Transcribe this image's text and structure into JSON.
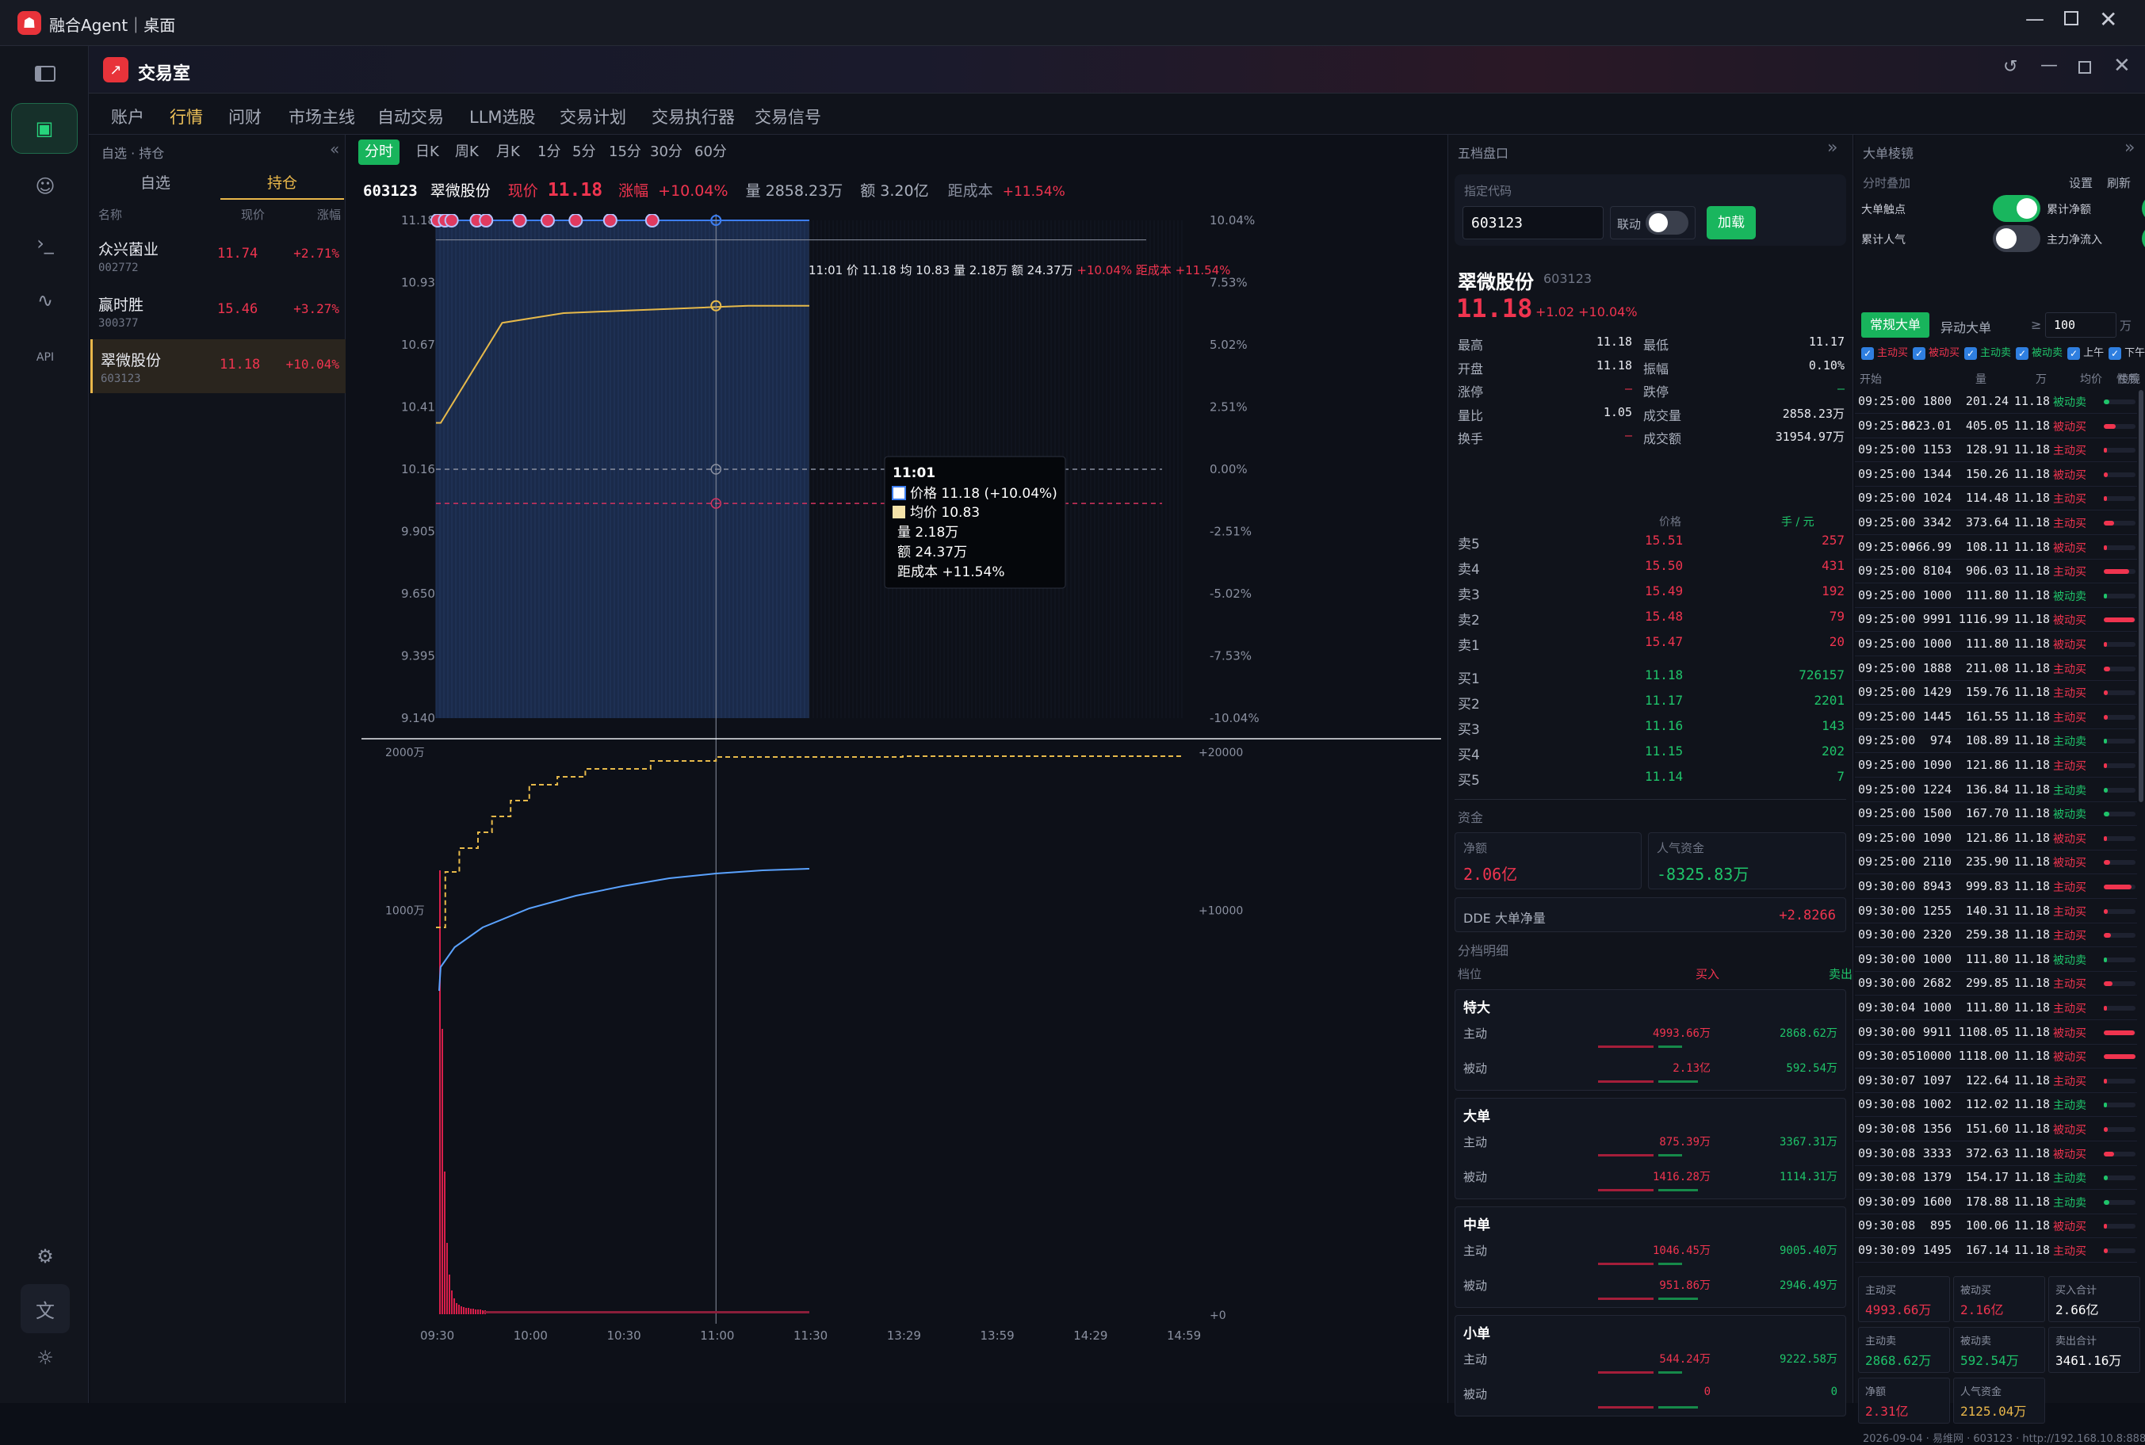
{
  "window": {
    "title": "融合Agent｜桌面",
    "min_icon": "minimize-icon",
    "max_icon": "maximize-icon",
    "close_icon": "close-icon"
  },
  "app": {
    "title": "交易室"
  },
  "tabs": [
    "账户",
    "行情",
    "问财",
    "市场主线",
    "自动交易",
    "LLM选股",
    "交易计划",
    "交易执行器",
    "交易信号"
  ],
  "active_tab": "行情",
  "watch": {
    "header": "自选 · 持仓",
    "segments": [
      "自选",
      "持仓"
    ],
    "active_segment": "持仓",
    "cols": [
      "名称",
      "现价",
      "涨幅"
    ],
    "items": [
      {
        "name": "众兴菌业",
        "code": "002772",
        "price": "11.74",
        "change": "+2.71%"
      },
      {
        "name": "赢时胜",
        "code": "300377",
        "price": "15.46",
        "change": "+3.27%"
      },
      {
        "name": "翠微股份",
        "code": "603123",
        "price": "11.18",
        "change": "+10.04%"
      }
    ]
  },
  "periods": [
    "分时",
    "日K",
    "周K",
    "月K",
    "1分",
    "5分",
    "15分",
    "30分",
    "60分"
  ],
  "active_period": "分时",
  "quote_bar": {
    "code": "603123",
    "name": "翠微股份",
    "price_label": "现价",
    "price": "11.18",
    "chg_label": "涨幅",
    "chg": "+10.04%",
    "vol": "量 2858.23万",
    "amt": "额 3.20亿",
    "cost_label": "距成本",
    "cost": "+11.54%"
  },
  "crosshair": {
    "label": "11:01 价 11.18 均 10.83 量 2.18万 额 24.37万",
    "pct": "+10.04%",
    "cost": "距成本 +11.54%"
  },
  "tooltip": {
    "time": "11:01",
    "price": "价格 11.18  (+10.04%)",
    "avg": "均价 10.83",
    "vol": "量 2.18万",
    "amt": "额 24.37万",
    "cost": "距成本 +11.54%"
  },
  "chart_data": {
    "type": "line",
    "price_axis": [
      "11.18",
      "10.93",
      "10.67",
      "10.41",
      "10.16",
      "9.905",
      "9.650",
      "9.395",
      "9.140"
    ],
    "pct_axis": [
      "10.04%",
      "7.53%",
      "5.02%",
      "2.51%",
      "0.00%",
      "-2.51%",
      "-5.02%",
      "-7.53%",
      "-10.04%"
    ],
    "x_ticks": [
      "09:30",
      "10:00",
      "10:30",
      "11:00",
      "11:30",
      "13:29",
      "13:59",
      "14:29",
      "14:59"
    ],
    "volume_axis_left": [
      "2000万",
      "1000万"
    ],
    "volume_axis_right": [
      "+20000",
      "+10000",
      "+0"
    ],
    "prev_close": 10.16,
    "cost_line": 10.02,
    "series": [
      {
        "name": "价格",
        "color": "#3d7ef0",
        "values": [
          11.18,
          11.18
        ]
      },
      {
        "name": "均价",
        "color": "#e6b94a",
        "values": [
          10.35,
          10.76,
          10.8,
          10.81,
          10.82,
          10.83,
          10.83
        ]
      }
    ],
    "big_order_marks": [
      "09:30",
      "09:31",
      "09:32",
      "09:40",
      "09:42",
      "09:55",
      "10:00",
      "10:12",
      "10:24",
      "10:42"
    ]
  },
  "five_level": {
    "title": "五档盘口",
    "code_label": "指定代码",
    "code_value": "603123",
    "link_label": "联动",
    "load_btn": "加载",
    "name": "翠微股份",
    "code": "603123",
    "price": "11.18",
    "chg": "+1.02 +10.04%",
    "stats": [
      [
        "最高",
        "11.18",
        "最低",
        "11.17"
      ],
      [
        "开盘",
        "11.18",
        "振幅",
        "0.10%"
      ],
      [
        "涨停",
        "—",
        "跌停",
        "—"
      ],
      [
        "量比",
        "1.05",
        "成交量",
        "2858.23万"
      ],
      [
        "换手",
        "—",
        "成交额",
        "31954.97万"
      ]
    ],
    "price_head": "价格",
    "unit_head": "手 / 元",
    "asks": [
      [
        "卖5",
        "15.51",
        "257"
      ],
      [
        "卖4",
        "15.50",
        "431"
      ],
      [
        "卖3",
        "15.49",
        "192"
      ],
      [
        "卖2",
        "15.48",
        "79"
      ],
      [
        "卖1",
        "15.47",
        "20"
      ]
    ],
    "bids": [
      [
        "买1",
        "11.18",
        "726157"
      ],
      [
        "买2",
        "11.17",
        "2201"
      ],
      [
        "买3",
        "11.16",
        "143"
      ],
      [
        "买4",
        "11.15",
        "202"
      ],
      [
        "买5",
        "11.14",
        "7"
      ]
    ],
    "fund_title": "资金",
    "net_label": "净额",
    "net_value": "2.06亿",
    "pop_label": "人气资金",
    "pop_value": "-8325.83万",
    "dde_label": "DDE 大单净量",
    "dde_value": "+2.8266",
    "detail_title": "分档明细",
    "detail_cols": [
      "档位",
      "买入",
      "卖出"
    ],
    "groups": [
      {
        "name": "特大",
        "rows": [
          [
            "主动",
            "4993.66万",
            "2868.62万"
          ],
          [
            "被动",
            "2.13亿",
            "592.54万"
          ]
        ]
      },
      {
        "name": "大单",
        "rows": [
          [
            "主动",
            "875.39万",
            "3367.31万"
          ],
          [
            "被动",
            "1416.28万",
            "1114.31万"
          ]
        ]
      },
      {
        "name": "中单",
        "rows": [
          [
            "主动",
            "1046.45万",
            "9005.40万"
          ],
          [
            "被动",
            "951.86万",
            "2946.49万"
          ]
        ]
      },
      {
        "name": "小单",
        "rows": [
          [
            "主动",
            "544.24万",
            "9222.58万"
          ],
          [
            "被动",
            "0",
            "0"
          ]
        ]
      }
    ]
  },
  "big_orders": {
    "title": "大单棱镜",
    "overlay": "分时叠加",
    "settings": "设置",
    "refresh": "刷新",
    "toggles": [
      [
        "大单触点",
        "on"
      ],
      [
        "累计净额",
        "on"
      ],
      [
        "累计人气",
        "off"
      ],
      [
        "主力净流入",
        "on"
      ]
    ],
    "mode_tabs": [
      "常规大单",
      "异动大单"
    ],
    "gte": "≥",
    "min_value": "100",
    "unit": "万",
    "filter": "≥ 100 万",
    "checks": [
      "主动买",
      "被动买",
      "主动卖",
      "被动卖",
      "上午",
      "下午"
    ],
    "cols": [
      "开始",
      "量",
      "万",
      "均价",
      "性质",
      "棱镜"
    ],
    "rows": [
      [
        "09:25:00",
        "1800",
        "201.24",
        "11.18",
        "被动卖",
        "g",
        "10"
      ],
      [
        "09:25:00",
        "3623.01",
        "405.05",
        "11.18",
        "被动买",
        "r",
        "22"
      ],
      [
        "09:25:00",
        "1153",
        "128.91",
        "11.18",
        "主动买",
        "r",
        "6"
      ],
      [
        "09:25:00",
        "1344",
        "150.26",
        "11.18",
        "被动买",
        "r",
        "8"
      ],
      [
        "09:25:00",
        "1024",
        "114.48",
        "11.18",
        "主动买",
        "r",
        "6"
      ],
      [
        "09:25:00",
        "3342",
        "373.64",
        "11.18",
        "主动买",
        "r",
        "20"
      ],
      [
        "09:25:00",
        "966.99",
        "108.11",
        "11.18",
        "被动买",
        "r",
        "6"
      ],
      [
        "09:25:00",
        "8104",
        "906.03",
        "11.18",
        "主动买",
        "r",
        "48"
      ],
      [
        "09:25:00",
        "1000",
        "111.80",
        "11.18",
        "被动卖",
        "g",
        "6"
      ],
      [
        "09:25:00",
        "9991",
        "1116.99",
        "11.18",
        "被动买",
        "r",
        "58"
      ],
      [
        "09:25:00",
        "1000",
        "111.80",
        "11.18",
        "被动买",
        "r",
        "6"
      ],
      [
        "09:25:00",
        "1888",
        "211.08",
        "11.18",
        "主动买",
        "r",
        "12"
      ],
      [
        "09:25:00",
        "1429",
        "159.76",
        "11.18",
        "主动买",
        "r",
        "8"
      ],
      [
        "09:25:00",
        "1445",
        "161.55",
        "11.18",
        "主动买",
        "r",
        "8"
      ],
      [
        "09:25:00",
        "974",
        "108.89",
        "11.18",
        "主动卖",
        "g",
        "6"
      ],
      [
        "09:25:00",
        "1090",
        "121.86",
        "11.18",
        "主动买",
        "r",
        "6"
      ],
      [
        "09:25:00",
        "1224",
        "136.84",
        "11.18",
        "主动卖",
        "g",
        "8"
      ],
      [
        "09:25:00",
        "1500",
        "167.70",
        "11.18",
        "被动卖",
        "g",
        "10"
      ],
      [
        "09:25:00",
        "1090",
        "121.86",
        "11.18",
        "被动买",
        "r",
        "6"
      ],
      [
        "09:25:00",
        "2110",
        "235.90",
        "11.18",
        "被动买",
        "r",
        "12"
      ],
      [
        "09:30:00",
        "8943",
        "999.83",
        "11.18",
        "主动买",
        "r",
        "52"
      ],
      [
        "09:30:00",
        "1255",
        "140.31",
        "11.18",
        "主动买",
        "r",
        "8"
      ],
      [
        "09:30:00",
        "2320",
        "259.38",
        "11.18",
        "主动买",
        "r",
        "14"
      ],
      [
        "09:30:00",
        "1000",
        "111.80",
        "11.18",
        "被动卖",
        "g",
        "6"
      ],
      [
        "09:30:00",
        "2682",
        "299.85",
        "11.18",
        "主动买",
        "r",
        "16"
      ],
      [
        "09:30:04",
        "1000",
        "111.80",
        "11.18",
        "主动买",
        "r",
        "6"
      ],
      [
        "09:30:00",
        "9911",
        "1108.05",
        "11.18",
        "被动买",
        "r",
        "58"
      ],
      [
        "09:30:05",
        "10000",
        "1118.00",
        "11.18",
        "被动买",
        "r",
        "60"
      ],
      [
        "09:30:07",
        "1097",
        "122.64",
        "11.18",
        "主动买",
        "r",
        "6"
      ],
      [
        "09:30:08",
        "1002",
        "112.02",
        "11.18",
        "主动卖",
        "g",
        "6"
      ],
      [
        "09:30:08",
        "1356",
        "151.60",
        "11.18",
        "被动买",
        "r",
        "8"
      ],
      [
        "09:30:08",
        "3333",
        "372.63",
        "11.18",
        "被动买",
        "r",
        "20"
      ],
      [
        "09:30:08",
        "1379",
        "154.17",
        "11.18",
        "主动卖",
        "g",
        "8"
      ],
      [
        "09:30:09",
        "1600",
        "178.88",
        "11.18",
        "主动卖",
        "g",
        "10"
      ],
      [
        "09:30:08",
        "895",
        "100.06",
        "11.18",
        "被动买",
        "r",
        "6"
      ],
      [
        "09:30:09",
        "1495",
        "167.14",
        "11.18",
        "主动买",
        "r",
        "8"
      ]
    ],
    "summary": [
      [
        "主动买",
        "4993.66万",
        "r"
      ],
      [
        "被动买",
        "2.16亿",
        "r"
      ],
      [
        "买入合计",
        "2.66亿",
        "w"
      ],
      [
        "主动卖",
        "2868.62万",
        "g"
      ],
      [
        "被动卖",
        "592.54万",
        "g"
      ],
      [
        "卖出合计",
        "3461.16万",
        "w"
      ],
      [
        "净额",
        "2.31亿",
        "r"
      ],
      [
        "人气资金",
        "2125.04万",
        "gold"
      ]
    ],
    "footer": "2026-09-04 · 易维网 · 603123 · http://192.168.10.8:8889"
  }
}
